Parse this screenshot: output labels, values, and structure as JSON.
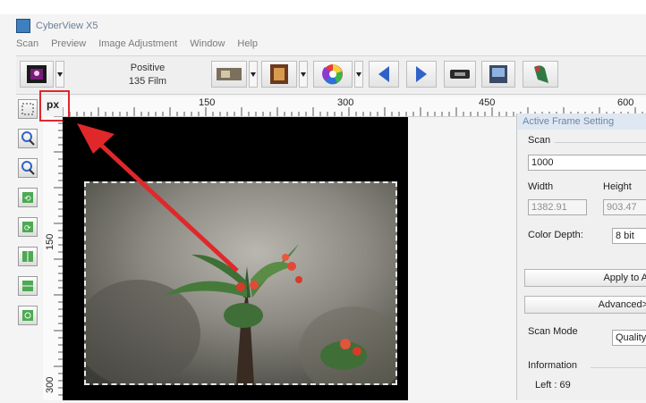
{
  "app": {
    "title": "CyberView X5"
  },
  "menu": [
    "Scan",
    "Preview",
    "Image Adjustment",
    "Window",
    "Help"
  ],
  "toolbar": {
    "film_line1": "Positive",
    "film_line2": "135 Film"
  },
  "ruler": {
    "unit": "px",
    "h_ticks": [
      "150",
      "300",
      "450",
      "600"
    ],
    "v_ticks": [
      "150",
      "300"
    ]
  },
  "panel": {
    "title": "Active Frame Setting",
    "scan_label": "Scan",
    "scan_value": "1000",
    "width_label": "Width",
    "height_label": "Height",
    "width_value": "1382.91",
    "height_value": "903.47",
    "color_depth_label": "Color Depth:",
    "color_depth_value": "8 bit",
    "apply_label": "Apply to A",
    "advanced_label": "Advanced>",
    "scan_mode_label": "Scan Mode",
    "scan_mode_value": "Quality",
    "information_label": "Information",
    "left_value": "Left : 69"
  },
  "colors": {
    "highlight_red": "#e0282a",
    "preview_bg": "#000000"
  },
  "icons": {
    "toolbar": [
      "preview-thumbnail-icon",
      "slide-tray-icon",
      "film-strip-icon",
      "color-wheel-icon",
      "prev-frame-icon",
      "next-frame-icon",
      "eject-icon",
      "scan-icon",
      "bird-icon"
    ],
    "left_tools": [
      "select-frame-icon",
      "zoom-in-icon",
      "zoom-out-icon",
      "rotate-left-icon",
      "rotate-right-icon",
      "flip-horizontal-icon",
      "flip-vertical-icon",
      "reset-icon"
    ]
  }
}
